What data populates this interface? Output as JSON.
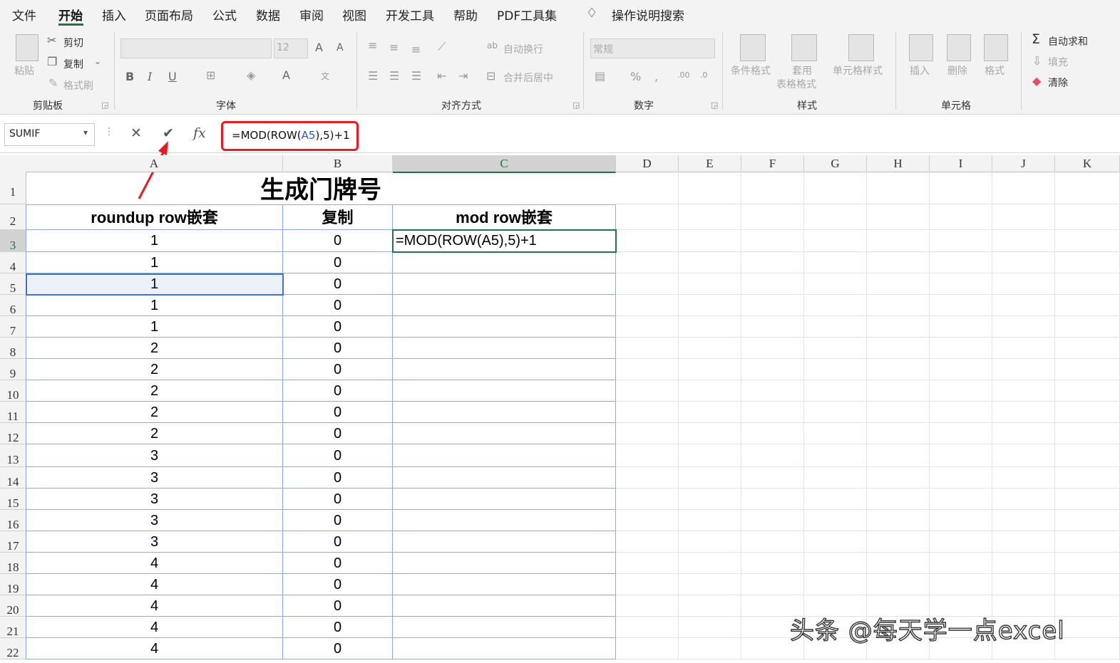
{
  "menu": {
    "items": [
      "文件",
      "开始",
      "插入",
      "页面布局",
      "公式",
      "数据",
      "审阅",
      "视图",
      "开发工具",
      "帮助",
      "PDF工具集"
    ],
    "active": "开始",
    "tell_me": "操作说明搜索"
  },
  "ribbon": {
    "clipboard": {
      "paste": "粘贴",
      "cut": "剪切",
      "copy": "复制",
      "format_painter": "格式刷",
      "label": "剪贴板"
    },
    "font": {
      "size": "12",
      "label": "字体"
    },
    "alignment": {
      "wrap": "自动换行",
      "merge": "合并后居中",
      "label": "对齐方式"
    },
    "number": {
      "format": "常规",
      "label": "数字"
    },
    "styles": {
      "conditional": "条件格式",
      "table_l1": "套用",
      "table_l2": "表格格式",
      "cell_styles": "单元格样式",
      "label": "样式"
    },
    "cells": {
      "insert": "插入",
      "delete": "删除",
      "format": "格式",
      "label": "单元格"
    },
    "editing": {
      "autosum": "自动求和",
      "fill": "填充",
      "clear": "清除"
    }
  },
  "formula_bar": {
    "name_box": "SUMIF",
    "formula_prefix": "=MOD(ROW(",
    "formula_ref": "A5",
    "formula_suffix": "),5)+1"
  },
  "sheet": {
    "columns": [
      "A",
      "B",
      "C",
      "D",
      "E",
      "F",
      "G",
      "H",
      "I",
      "J",
      "K"
    ],
    "rows": [
      "1",
      "2",
      "3",
      "4",
      "5",
      "6",
      "7",
      "8",
      "9",
      "10",
      "11",
      "12",
      "13",
      "14",
      "15",
      "16",
      "17",
      "18",
      "19",
      "20",
      "21",
      "22"
    ],
    "title": "生成门牌号",
    "headers": [
      "roundup  row嵌套",
      "复制",
      "mod  row嵌套"
    ],
    "col_a_values": [
      "1",
      "1",
      "1",
      "1",
      "1",
      "2",
      "2",
      "2",
      "2",
      "2",
      "3",
      "3",
      "3",
      "3",
      "3",
      "4",
      "4",
      "4",
      "4",
      "4"
    ],
    "col_b_values": [
      "0",
      "0",
      "0",
      "0",
      "0",
      "0",
      "0",
      "0",
      "0",
      "0",
      "0",
      "0",
      "0",
      "0",
      "0",
      "0",
      "0",
      "0",
      "0",
      "0"
    ],
    "active_cell_content": "=MOD(ROW(A5),5)+1"
  },
  "watermark": "头条 @每天学一点excel",
  "colors": {
    "accent": "#217346",
    "highlight": "#e31c23",
    "ref": "#4472c4"
  }
}
